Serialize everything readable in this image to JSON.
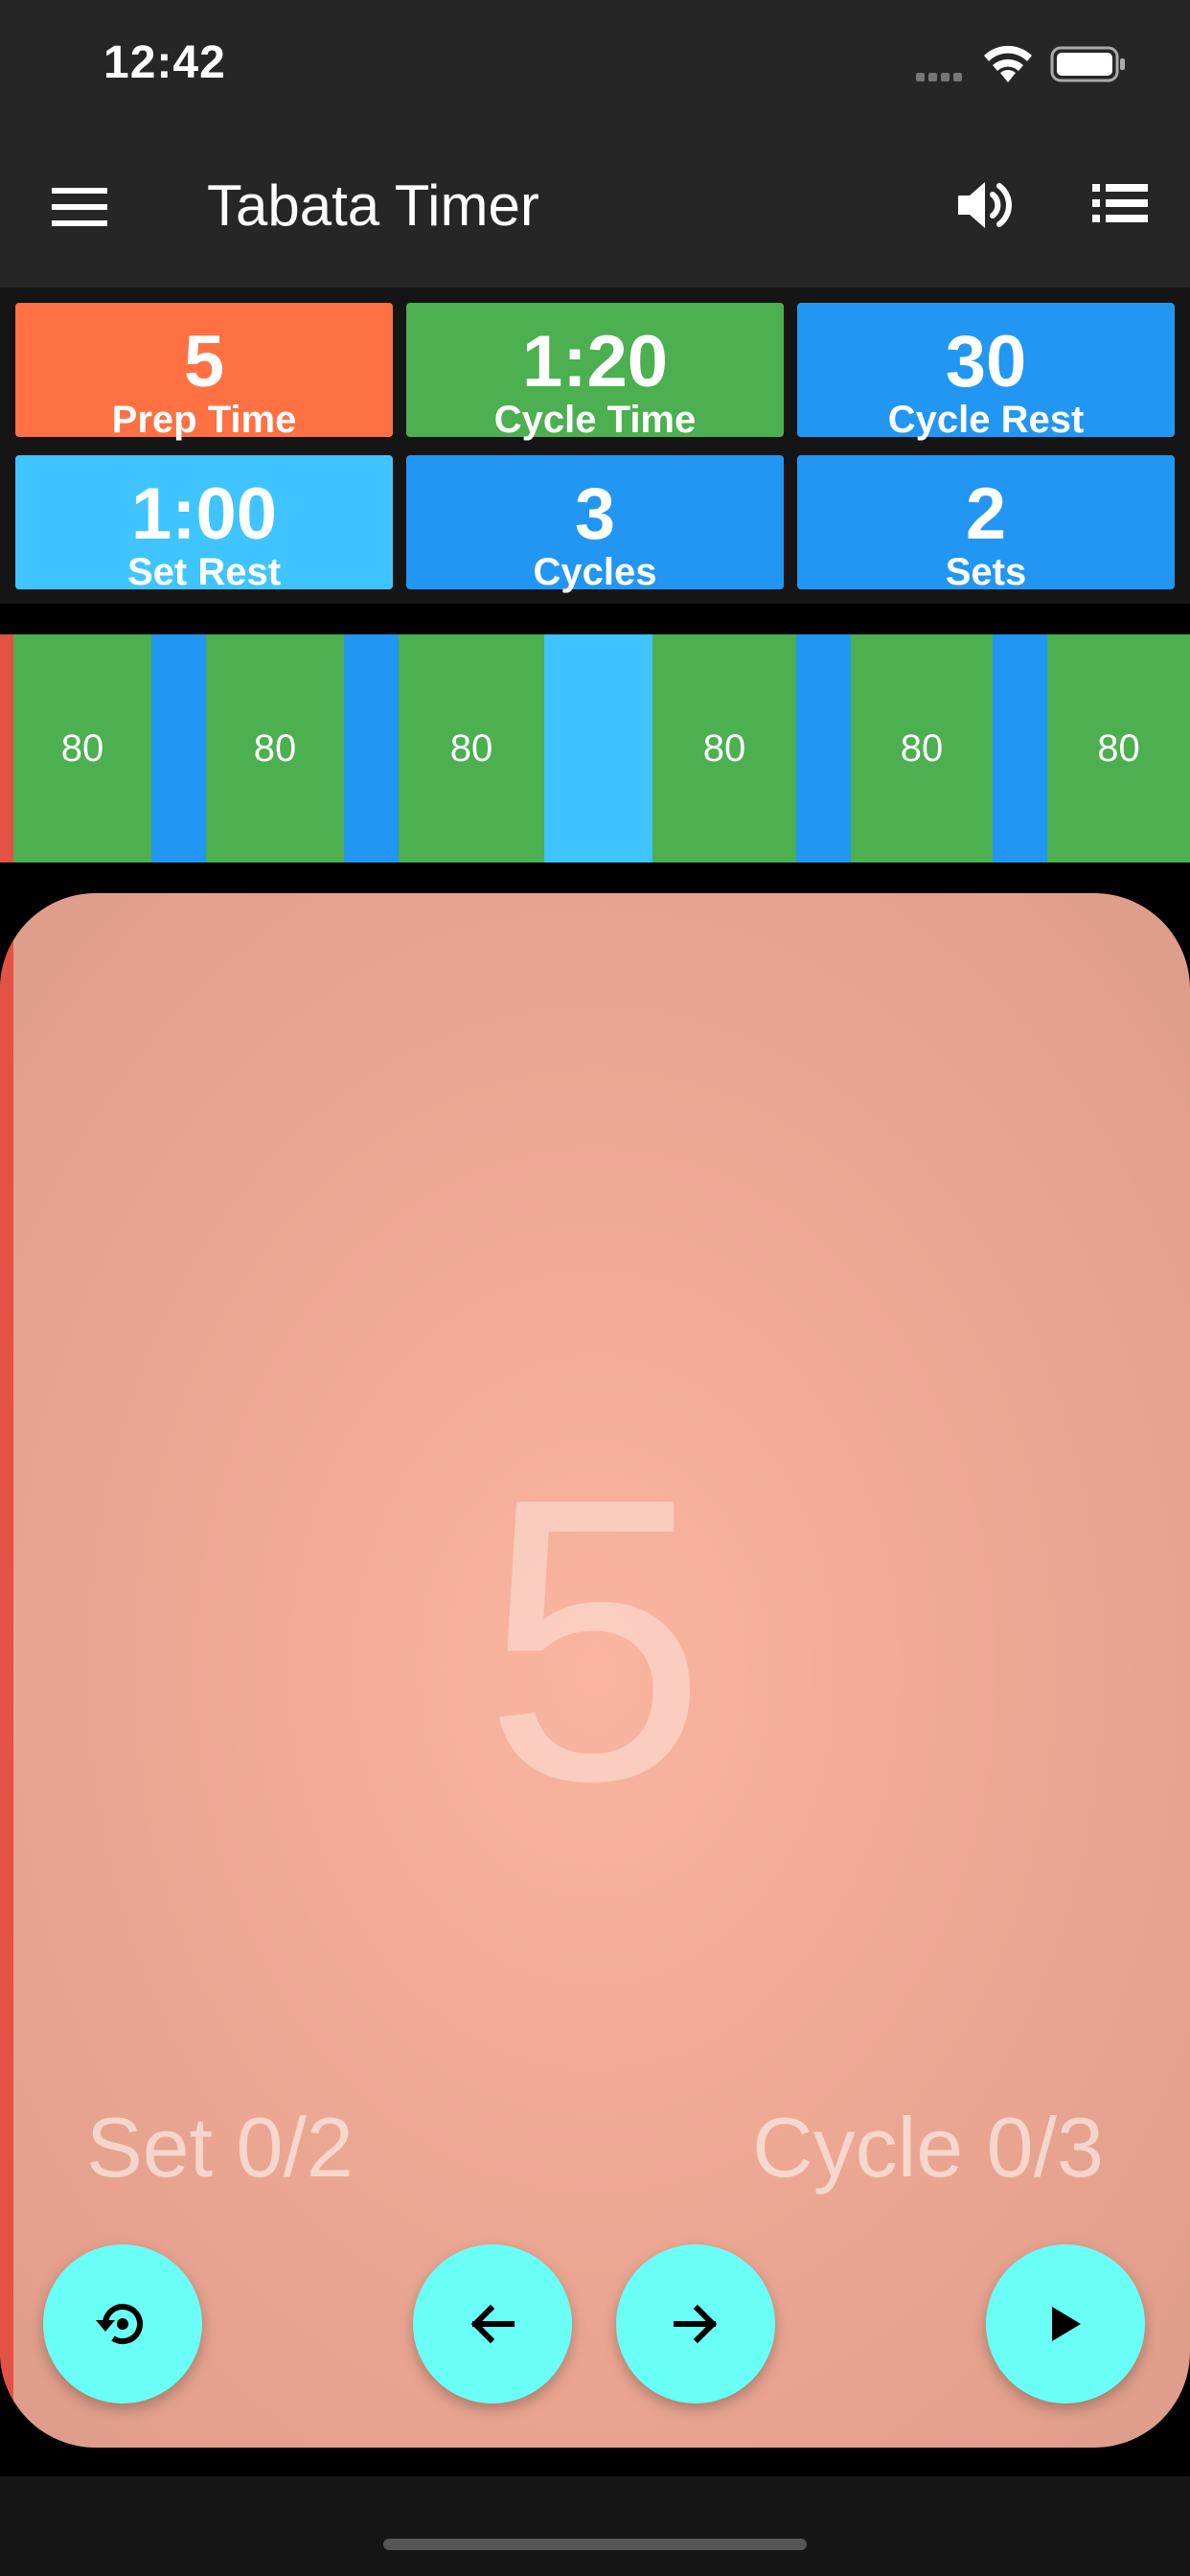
{
  "status": {
    "time": "12:42"
  },
  "appbar": {
    "title": "Tabata Timer"
  },
  "tiles": [
    {
      "value": "5",
      "label": "Prep Time",
      "color": "#ff7043"
    },
    {
      "value": "1:20",
      "label": "Cycle Time",
      "color": "#4caf50"
    },
    {
      "value": "30",
      "label": "Cycle Rest",
      "color": "#2196f3"
    },
    {
      "value": "1:00",
      "label": "Set Rest",
      "color": "#40c4ff"
    },
    {
      "value": "3",
      "label": "Cycles",
      "color": "#2196f3"
    },
    {
      "value": "2",
      "label": "Sets",
      "color": "#2196f3"
    }
  ],
  "timeline": {
    "colors": {
      "prep": "#e35245",
      "work": "#4caf50",
      "rest": "#2196f3",
      "setrest": "#40c4ff"
    },
    "work_labels": [
      "80",
      "80",
      "80",
      "80",
      "80",
      "80"
    ]
  },
  "timer": {
    "value": "5",
    "set_text": "Set 0/2",
    "cycle_text": "Cycle 0/3"
  },
  "controls": {
    "accent": "#69fff6",
    "icons": [
      "reset-icon",
      "arrow-left-icon",
      "arrow-right-icon",
      "play-icon"
    ]
  }
}
